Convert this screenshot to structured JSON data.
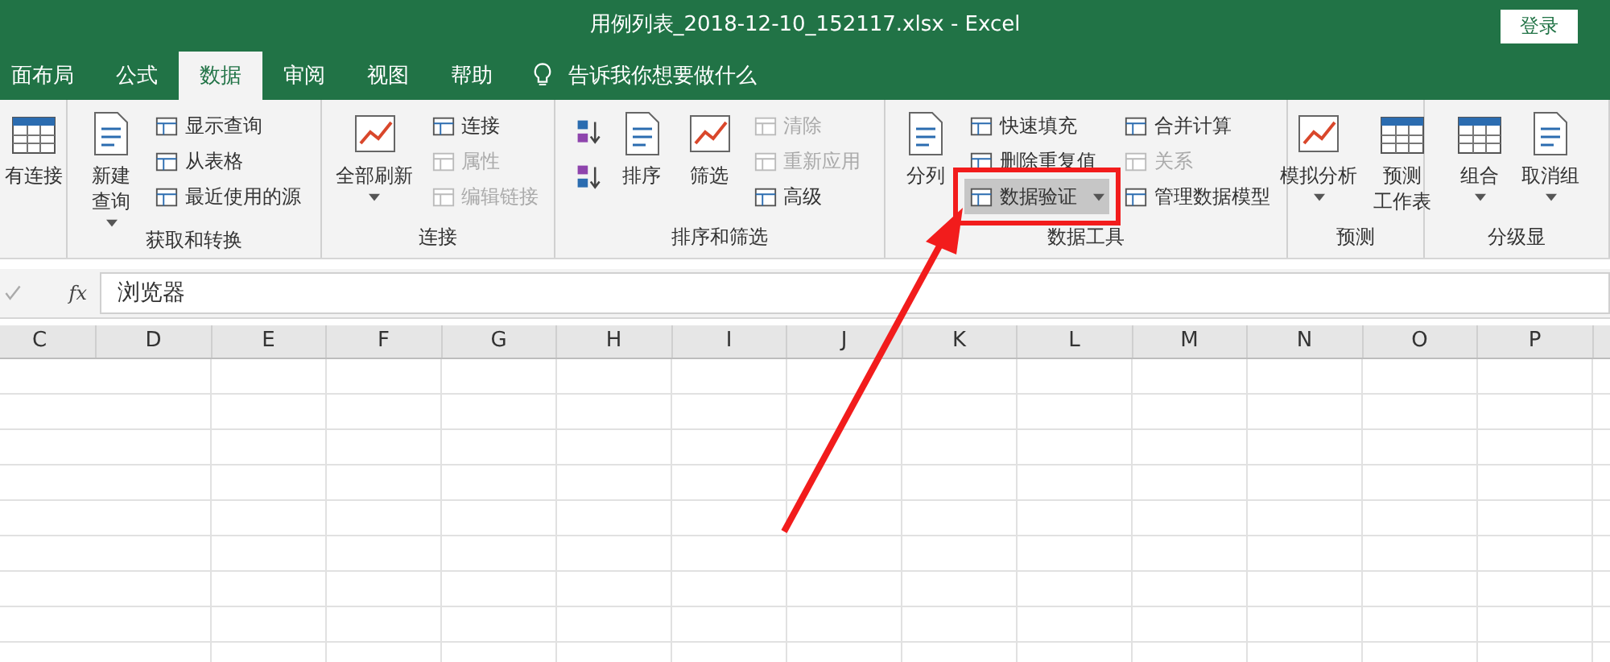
{
  "window": {
    "title": "用例列表_2018-12-10_152117.xlsx  -  Excel",
    "login": "登录"
  },
  "tabs": [
    {
      "label": "面布局",
      "selected": false
    },
    {
      "label": "公式",
      "selected": false
    },
    {
      "label": "数据",
      "selected": true
    },
    {
      "label": "审阅",
      "selected": false
    },
    {
      "label": "视图",
      "selected": false
    },
    {
      "label": "帮助",
      "selected": false
    }
  ],
  "tell_me": {
    "placeholder": "告诉我你想要做什么"
  },
  "ribbon_groups": [
    {
      "columns": [
        {
          "kind": "large",
          "lines": [
            "有连接"
          ],
          "dropdown": false
        }
      ]
    },
    {
      "label": "获取和转换",
      "columns": [
        {
          "kind": "large",
          "lines": [
            "新建",
            "查询"
          ],
          "dropdown": true
        },
        {
          "kind": "stack",
          "items": [
            {
              "label": "显示查询",
              "disabled": false,
              "highlighted": false,
              "dropdown": false
            },
            {
              "label": "从表格",
              "disabled": false,
              "highlighted": false,
              "dropdown": false
            },
            {
              "label": "最近使用的源",
              "disabled": false,
              "highlighted": false,
              "dropdown": false
            }
          ]
        }
      ]
    },
    {
      "label": "连接",
      "columns": [
        {
          "kind": "large",
          "lines": [
            "全部刷新"
          ],
          "dropdown": true
        },
        {
          "kind": "stack",
          "items": [
            {
              "label": "连接",
              "disabled": false,
              "highlighted": false,
              "dropdown": false
            },
            {
              "label": "属性",
              "disabled": true,
              "highlighted": false,
              "dropdown": false
            },
            {
              "label": "编辑链接",
              "disabled": true,
              "highlighted": false,
              "dropdown": false
            }
          ]
        }
      ]
    },
    {
      "label": "排序和筛选",
      "columns": [
        {
          "kind": "sorticons"
        },
        {
          "kind": "large",
          "lines": [
            "排序"
          ],
          "dropdown": false
        },
        {
          "kind": "large",
          "lines": [
            "筛选"
          ],
          "dropdown": false
        },
        {
          "kind": "stack",
          "items": [
            {
              "label": "清除",
              "disabled": true,
              "highlighted": false,
              "dropdown": false
            },
            {
              "label": "重新应用",
              "disabled": true,
              "highlighted": false,
              "dropdown": false
            },
            {
              "label": "高级",
              "disabled": false,
              "highlighted": false,
              "dropdown": false
            }
          ]
        }
      ]
    },
    {
      "label": "数据工具",
      "columns": [
        {
          "kind": "large",
          "lines": [
            "分列"
          ],
          "dropdown": false
        },
        {
          "kind": "stack",
          "items": [
            {
              "label": "快速填充",
              "disabled": false,
              "highlighted": false,
              "dropdown": false
            },
            {
              "label": "删除重复值",
              "disabled": false,
              "highlighted": false,
              "dropdown": false
            },
            {
              "label": "数据验证",
              "disabled": false,
              "highlighted": true,
              "dropdown": true
            }
          ]
        },
        {
          "kind": "stack",
          "items": [
            {
              "label": "合并计算",
              "disabled": false,
              "highlighted": false,
              "dropdown": false
            },
            {
              "label": "关系",
              "disabled": true,
              "highlighted": false,
              "dropdown": false
            },
            {
              "label": "管理数据模型",
              "disabled": false,
              "highlighted": false,
              "dropdown": false
            }
          ]
        }
      ]
    },
    {
      "label": "预测",
      "columns": [
        {
          "kind": "large",
          "lines": [
            "模拟分析"
          ],
          "dropdown": true
        },
        {
          "kind": "large",
          "lines": [
            "预测",
            "工作表"
          ],
          "dropdown": false
        }
      ]
    },
    {
      "label": "分级显",
      "columns": [
        {
          "kind": "large",
          "lines": [
            "组合"
          ],
          "dropdown": true
        },
        {
          "kind": "large",
          "lines": [
            "取消组"
          ],
          "dropdown": true
        }
      ]
    }
  ],
  "formula_bar": {
    "function_label": "fx",
    "value": "浏览器"
  },
  "columns": [
    "C",
    "D",
    "E",
    "F",
    "G",
    "H",
    "I",
    "J",
    "K",
    "L",
    "M",
    "N",
    "O",
    "P"
  ]
}
